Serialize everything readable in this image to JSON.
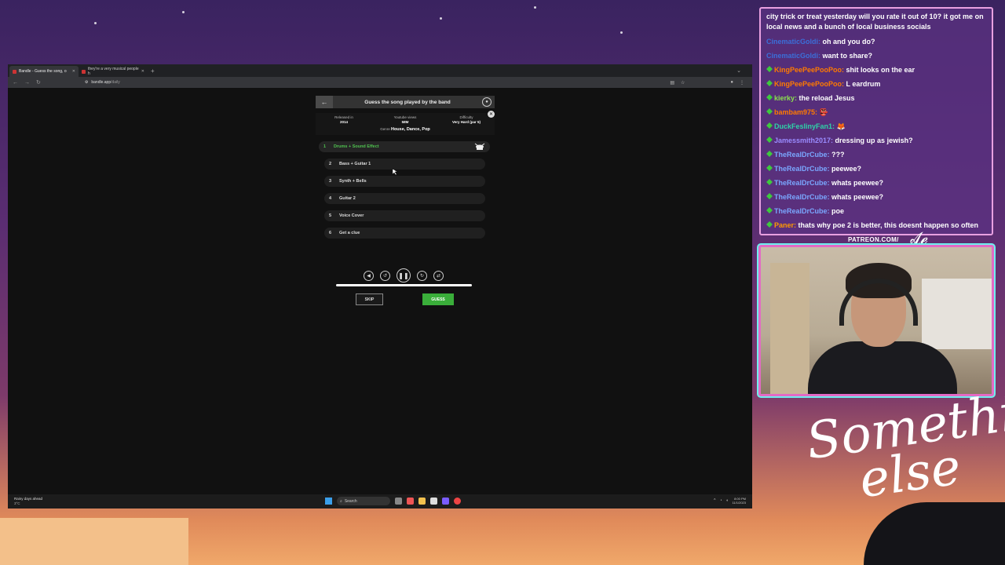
{
  "browser": {
    "tabs": [
      {
        "title": "Bandle - Guess the song, o",
        "active": true
      },
      {
        "title": "they're a very musical people h",
        "active": false
      }
    ],
    "url_domain": "bandle.app",
    "url_path": "/daily"
  },
  "game": {
    "title": "Guess the song played by the band",
    "info": {
      "released_label": "Released in",
      "released_value": "2014",
      "views_label": "Youtube views",
      "views_value": "58M",
      "difficulty_label": "Difficulty",
      "difficulty_value": "Very Hard (par 5)",
      "genre_label": "Genre",
      "genre_value": "House, Dance, Pop"
    },
    "clues": [
      {
        "num": "1",
        "label": "Drums + Sound Effect"
      },
      {
        "num": "2",
        "label": "Bass + Guitar 1"
      },
      {
        "num": "3",
        "label": "Synth + Bells"
      },
      {
        "num": "4",
        "label": "Guitar 2"
      },
      {
        "num": "5",
        "label": "Voice Cover"
      },
      {
        "num": "6",
        "label": "Get a clue"
      }
    ],
    "progress_fraction": 1.0,
    "skip_label": "SKIP",
    "guess_label": "GUESS",
    "accent_color": "#3aae3a"
  },
  "taskbar": {
    "weather_title": "Rainy days ahead",
    "weather_temp": "3°C",
    "search_placeholder": "Search",
    "time": "8:00 PM",
    "date": "11/1/2023"
  },
  "chat": {
    "first_message": "city trick or treat yesterday will you rate it out of 10? it got me on local news and a bunch of local business socials",
    "messages": [
      {
        "user": "CinematicGoldi",
        "color": "#3b6fd9",
        "text": "oh and you do?",
        "badge": false
      },
      {
        "user": "CinematicGoldi",
        "color": "#3b6fd9",
        "text": "want to share?",
        "badge": false
      },
      {
        "user": "KingPeePeePooPoo",
        "color": "#ff7a00",
        "text": "shit looks on the ear",
        "badge": true
      },
      {
        "user": "KingPeePeePooPoo",
        "color": "#ff7a00",
        "text": "L eardrum",
        "badge": true
      },
      {
        "user": "kierky",
        "color": "#8be04e",
        "text": "the reload Jesus",
        "badge": true
      },
      {
        "user": "bambam975",
        "color": "#ff7a00",
        "text": "👺",
        "badge": true
      },
      {
        "user": "DuckFeslinyFan1",
        "color": "#2ed3a8",
        "text": "🦊",
        "badge": true
      },
      {
        "user": "Jamessmith2017",
        "color": "#9a8cff",
        "text": "dressing up as jewish?",
        "badge": true
      },
      {
        "user": "TheRealDrCube",
        "color": "#7aa7ff",
        "text": "???",
        "badge": true
      },
      {
        "user": "TheRealDrCube",
        "color": "#7aa7ff",
        "text": "peewee?",
        "badge": true
      },
      {
        "user": "TheRealDrCube",
        "color": "#7aa7ff",
        "text": "whats peewee?",
        "badge": true
      },
      {
        "user": "TheRealDrCube",
        "color": "#7aa7ff",
        "text": "whats peewee?",
        "badge": true
      },
      {
        "user": "TheRealDrCube",
        "color": "#7aa7ff",
        "text": "poe",
        "badge": true
      },
      {
        "user": "Paner",
        "color": "#ff9a00",
        "text": "thats why poe 2 is better, this doesnt happen so often",
        "badge": true
      }
    ]
  },
  "overlay": {
    "patreon": "PATREON.COM/",
    "signature_small": "Anything else",
    "logo_line1": "Something",
    "logo_line2": "else"
  }
}
